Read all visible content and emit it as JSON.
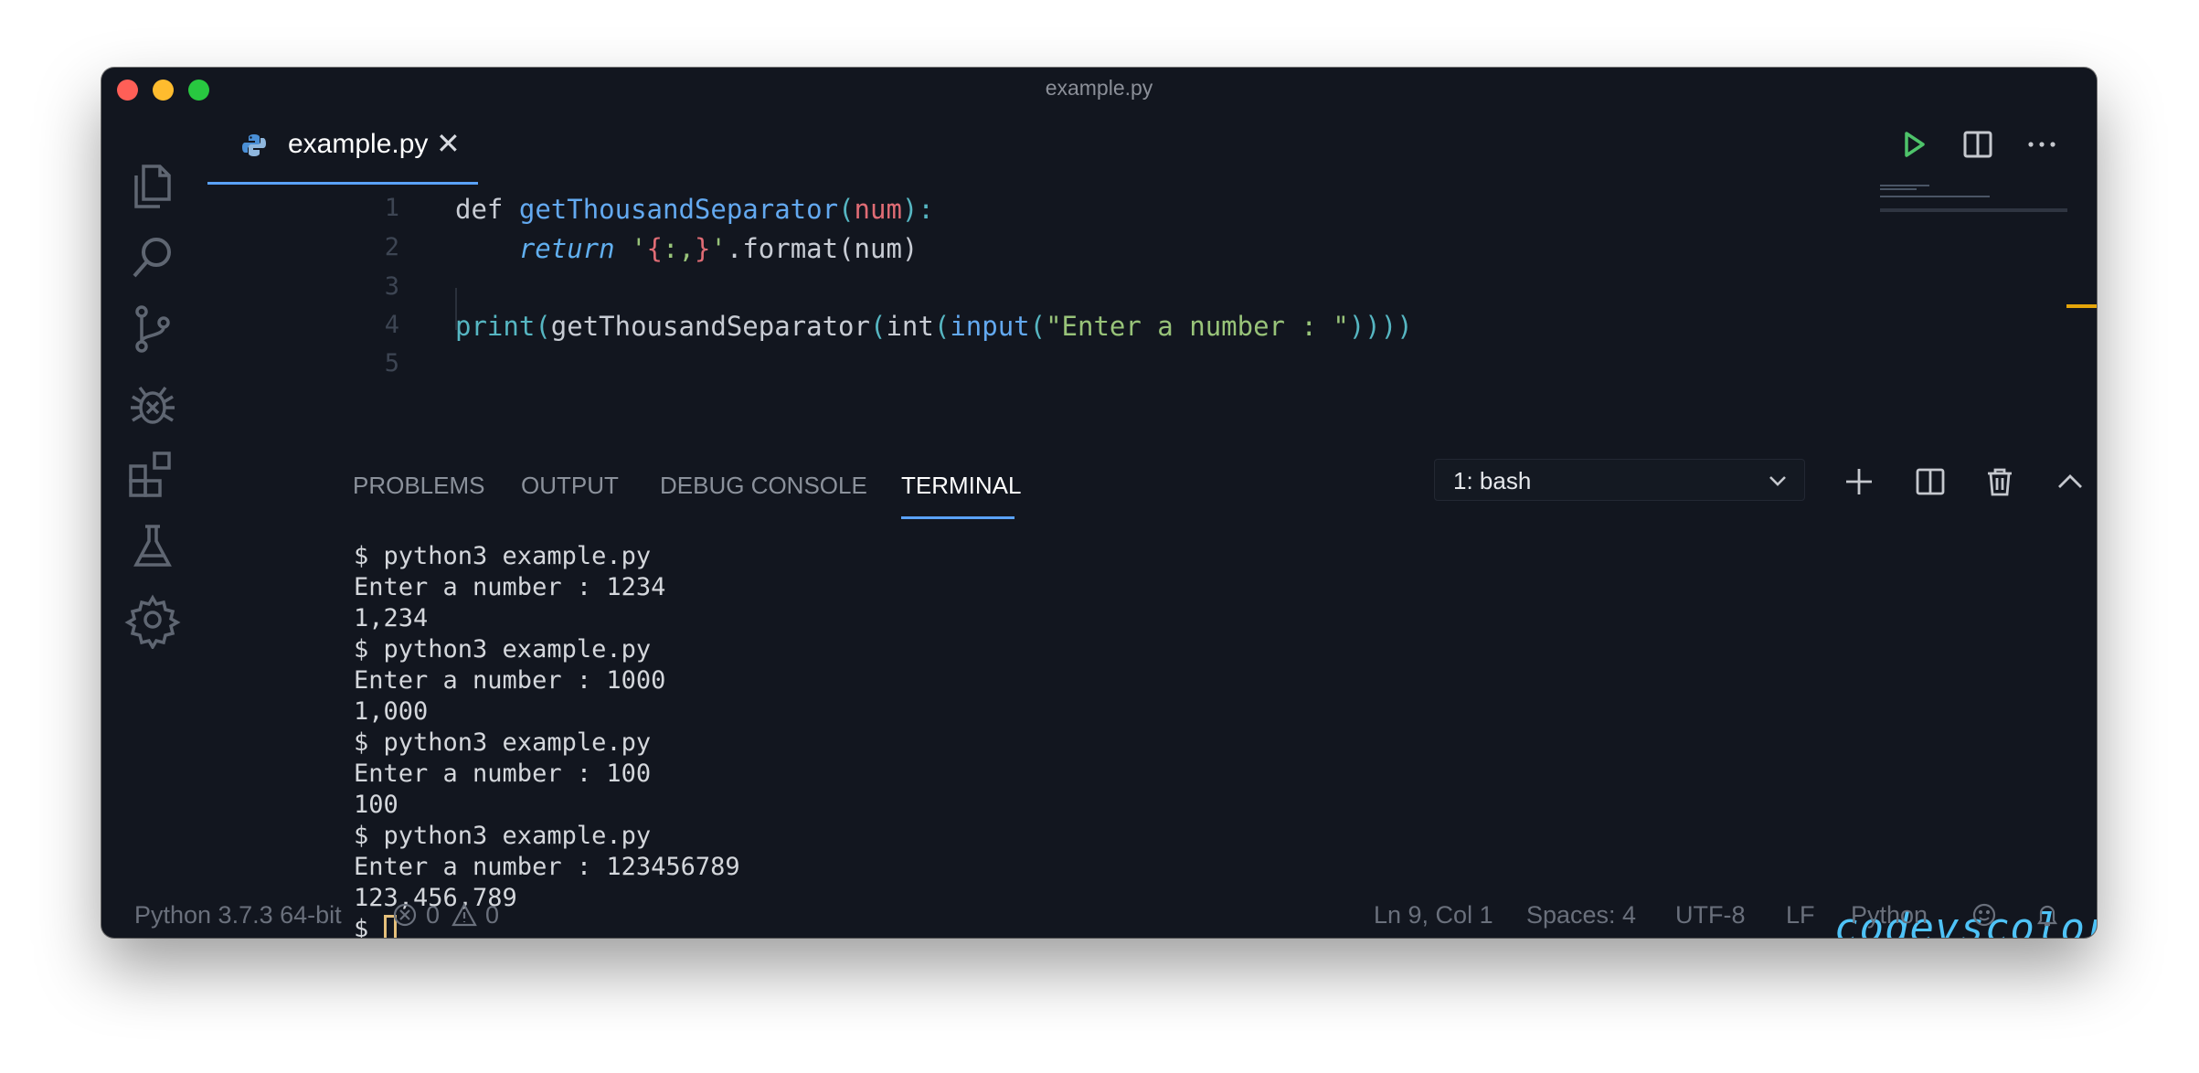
{
  "window": {
    "title": "example.py"
  },
  "tabs": [
    {
      "label": "example.py",
      "close": "✕"
    }
  ],
  "editor": {
    "lines": [
      {
        "num": "1"
      },
      {
        "num": "2"
      },
      {
        "num": "3"
      },
      {
        "num": "4"
      },
      {
        "num": "5"
      }
    ],
    "code": {
      "l1": {
        "def": "def",
        "fname": "getThousandSeparator",
        "po": "(",
        "param": "num",
        "pc": "):"
      },
      "l2": {
        "ret": "return",
        "q1": "'",
        "b1": "{",
        "fmtspec": ":,",
        "b2": "}",
        "q2": "'",
        "method": ".format(num)"
      },
      "l4": {
        "print": "print",
        "p1": "(",
        "call": "getThousandSeparator",
        "p2": "(",
        "int": "int",
        "p3": "(",
        "input": "input",
        "p4": "(",
        "str": "\"Enter a number : \"",
        "close": "))))"
      }
    }
  },
  "panel": {
    "tabs": [
      "PROBLEMS",
      "OUTPUT",
      "DEBUG CONSOLE",
      "TERMINAL"
    ],
    "active_tab": "TERMINAL",
    "terminal_select": "1: bash",
    "terminal_lines": [
      "$ python3 example.py",
      "Enter a number : 1234",
      "1,234",
      "$ python3 example.py",
      "Enter a number : 1000",
      "1,000",
      "$ python3 example.py",
      "Enter a number : 100",
      "100",
      "$ python3 example.py",
      "Enter a number : 123456789",
      "123,456,789"
    ],
    "prompt": "$ ",
    "watermark": "codevscolor.com"
  },
  "statusbar": {
    "interpreter": "Python 3.7.3 64-bit",
    "errors": "0",
    "warnings": "0",
    "position": "Ln 9, Col 1",
    "spaces": "Spaces: 4",
    "encoding": "UTF-8",
    "eol": "LF",
    "language": "Python"
  },
  "colors": {
    "background": "#12161f",
    "accent": "#5aa2ff",
    "run_button": "#4ec36a",
    "watermark": "#4fc3f7"
  },
  "icons": {
    "activity": [
      "files-icon",
      "search-icon",
      "source-control-icon",
      "debug-icon",
      "extensions-icon",
      "testing-icon",
      "settings-gear-icon"
    ],
    "editor_actions": [
      "run-icon",
      "split-editor-icon",
      "more-icon"
    ],
    "panel_actions": [
      "chevron-down-icon",
      "plus-icon",
      "split-terminal-icon",
      "trash-icon",
      "maximize-chevron-up-icon",
      "close-icon"
    ]
  }
}
